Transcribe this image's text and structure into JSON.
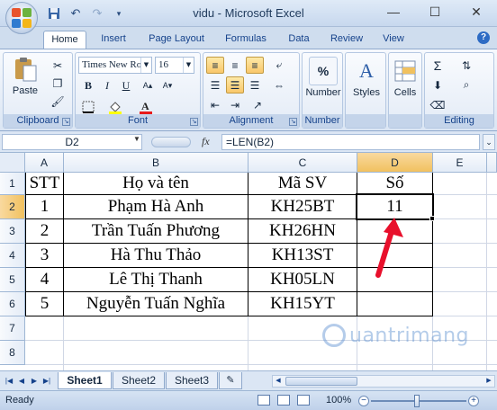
{
  "window": {
    "title": "vidu - Microsoft Excel",
    "controls": [
      "—",
      "☐",
      "✕"
    ]
  },
  "quick_access": [
    "save-icon",
    "undo-icon",
    "redo-icon",
    "customize-icon"
  ],
  "tabs": [
    "Home",
    "Insert",
    "Page Layout",
    "Formulas",
    "Data",
    "Review",
    "View"
  ],
  "ribbon": {
    "clipboard": {
      "label": "Clipboard",
      "paste": "Paste"
    },
    "font": {
      "label": "Font",
      "font_name": "Times New Ro",
      "font_size": "16"
    },
    "alignment": {
      "label": "Alignment"
    },
    "number": {
      "label": "Number",
      "button": "Number"
    },
    "styles": {
      "button": "Styles"
    },
    "cells": {
      "button": "Cells"
    },
    "editing": {
      "label": "Editing"
    }
  },
  "formula_bar": {
    "name_box": "D2",
    "fx": "fx",
    "formula": "=LEN(B2)"
  },
  "grid": {
    "columns": [
      "A",
      "B",
      "C",
      "D",
      "E"
    ],
    "rows": [
      "1",
      "2",
      "3",
      "4",
      "5",
      "6",
      "7",
      "8"
    ],
    "cells": [
      [
        "STT",
        "Họ và tên",
        "Mã SV",
        "Số"
      ],
      [
        "1",
        "Phạm Hà Anh",
        "KH25BT",
        "11"
      ],
      [
        "2",
        "Trần Tuấn Phương",
        "KH26HN",
        ""
      ],
      [
        "3",
        "Hà Thu Thảo",
        "KH13ST",
        ""
      ],
      [
        "4",
        "Lê Thị Thanh",
        "KH05LN",
        ""
      ],
      [
        "5",
        "Nguyễn Tuấn Nghĩa",
        "KH15YT",
        ""
      ]
    ],
    "active_cell": "D2"
  },
  "sheets": [
    "Sheet1",
    "Sheet2",
    "Sheet3"
  ],
  "active_sheet": "Sheet1",
  "status": {
    "ready": "Ready",
    "zoom": "100%"
  },
  "watermark": "uantrimang",
  "colors": {
    "arrow": "#e8102c",
    "selection_header": "#f1c15f",
    "ribbon_text": "#15428b"
  }
}
